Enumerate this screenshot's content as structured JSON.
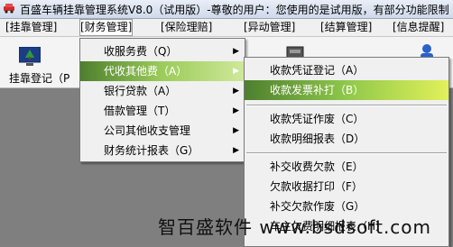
{
  "window": {
    "title": "百盛车辆挂靠管理系统V8.0（试用版）-尊敬的用户：您使用的是试用版，有部分功能限制"
  },
  "menubar": {
    "items": [
      {
        "label": "[挂靠管理]"
      },
      {
        "label": "[财务管理]",
        "active": true
      },
      {
        "label": "[保险理赔]"
      },
      {
        "label": "[异动管理]"
      },
      {
        "label": "[结算管理]"
      },
      {
        "label": "[信息提醒]"
      }
    ]
  },
  "toolbar": {
    "buttons": [
      {
        "label": "挂靠登记（P"
      }
    ]
  },
  "finance_menu": {
    "items": [
      {
        "label": "收服务费（Q）",
        "has_submenu": true
      },
      {
        "label": "代收其他费（A）",
        "has_submenu": true,
        "highlighted": true
      },
      {
        "label": "银行贷款（A）",
        "has_submenu": true
      },
      {
        "label": "借款管理（T）",
        "has_submenu": true
      },
      {
        "label": "公司其他收支管理",
        "has_submenu": true
      },
      {
        "label": "财务统计报表（G）",
        "has_submenu": true
      }
    ]
  },
  "submenu": {
    "groups": [
      [
        {
          "label": "收款凭证登记（A）"
        },
        {
          "label": "收款发票补打（B）",
          "highlighted": true
        }
      ],
      [
        {
          "label": "收款凭证作废（C）"
        },
        {
          "label": "收款明细报表（D）"
        }
      ],
      [
        {
          "label": "补交收费欠款（E）"
        },
        {
          "label": "欠款收据打印（F）"
        },
        {
          "label": "补交欠款作废（G）"
        },
        {
          "label": "车主欠费明细报表（H）"
        }
      ]
    ]
  },
  "watermark": {
    "text": "智百盛软件 www.bsdsoft.com"
  },
  "colors": {
    "highlight_start": "#4e7f2e",
    "highlight_end": "#e2f05a",
    "menu_bg": "#f0f0f0",
    "client_bg": "#7f7f7f"
  }
}
